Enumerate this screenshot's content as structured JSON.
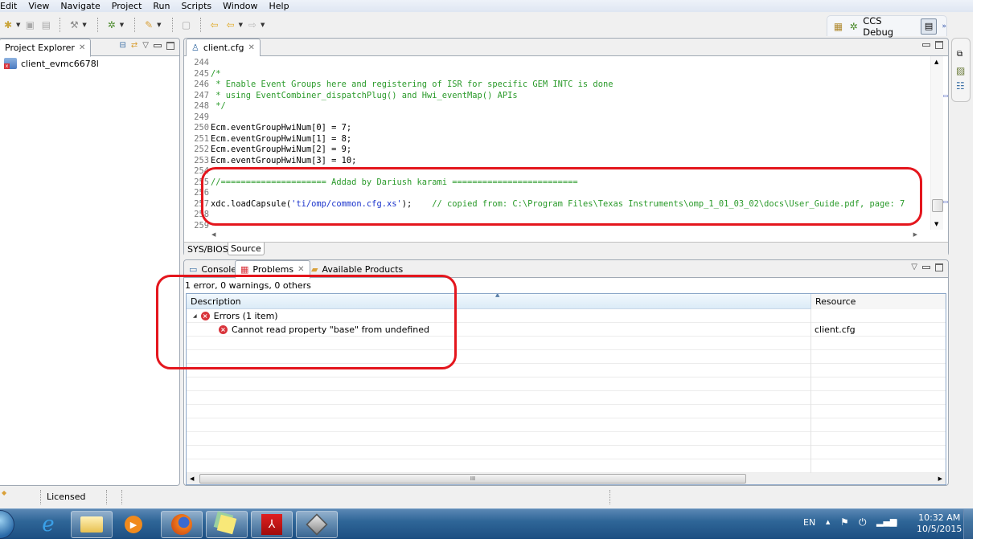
{
  "menu": [
    "Edit",
    "View",
    "Navigate",
    "Project",
    "Run",
    "Scripts",
    "Window",
    "Help"
  ],
  "toolbar": {
    "icons": [
      "new-icon",
      "save-icon",
      "save-all-icon",
      "build-icon",
      "debug-icon",
      "flash-icon",
      "terminate-icon",
      "last-edit-icon",
      "back-icon",
      "forward-icon"
    ]
  },
  "perspective": {
    "label": "CCS Debug",
    "more": "»"
  },
  "project_explorer": {
    "title": "Project Explorer",
    "items": [
      {
        "label": "client_evmc6678l",
        "badge": "RTSC"
      }
    ]
  },
  "editor": {
    "tab": "client.cfg",
    "lines": [
      {
        "n": "244",
        "parts": []
      },
      {
        "n": "245",
        "parts": [
          {
            "t": "/*",
            "c": "cm"
          }
        ]
      },
      {
        "n": "246",
        "parts": [
          {
            "t": " * Enable Event Groups here and registering of ISR for specific GEM INTC is done",
            "c": "cm"
          }
        ]
      },
      {
        "n": "247",
        "parts": [
          {
            "t": " * using EventCombiner_dispatchPlug() and Hwi_eventMap() APIs",
            "c": "cm"
          }
        ]
      },
      {
        "n": "248",
        "parts": [
          {
            "t": " */",
            "c": "cm"
          }
        ]
      },
      {
        "n": "249",
        "parts": []
      },
      {
        "n": "250",
        "parts": [
          {
            "t": "Ecm.eventGroupHwiNum[0] = 7;",
            "c": ""
          }
        ]
      },
      {
        "n": "251",
        "parts": [
          {
            "t": "Ecm.eventGroupHwiNum[1] = 8;",
            "c": ""
          }
        ]
      },
      {
        "n": "252",
        "parts": [
          {
            "t": "Ecm.eventGroupHwiNum[2] = 9;",
            "c": ""
          }
        ]
      },
      {
        "n": "253",
        "parts": [
          {
            "t": "Ecm.eventGroupHwiNum[3] = 10;",
            "c": ""
          }
        ]
      },
      {
        "n": "254",
        "parts": []
      },
      {
        "n": "255",
        "parts": [
          {
            "t": "//===================== Addad by Dariush karami =========================",
            "c": "cm"
          }
        ]
      },
      {
        "n": "256",
        "parts": []
      },
      {
        "n": "257",
        "parts": [
          {
            "t": "xdc.loadCapsule(",
            "c": ""
          },
          {
            "t": "'ti/omp/common.cfg.xs'",
            "c": "str"
          },
          {
            "t": ");    ",
            "c": ""
          },
          {
            "t": "// copied from: C:\\Program Files\\Texas Instruments\\omp_1_01_03_02\\docs\\User_Guide.pdf, page: 7",
            "c": "cm"
          }
        ]
      },
      {
        "n": "258",
        "parts": []
      },
      {
        "n": "259",
        "parts": []
      }
    ],
    "bottom_tabs": [
      "SYS/BIOS",
      "Source"
    ],
    "active_bottom_tab": "Source"
  },
  "bottom_panel": {
    "tabs": [
      {
        "label": "Console",
        "icon": "console-icon"
      },
      {
        "label": "Problems",
        "icon": "problems-icon",
        "active": true
      },
      {
        "label": "Available Products",
        "icon": "folder-icon"
      }
    ],
    "summary": "1 error, 0 warnings, 0 others",
    "columns": [
      "Description",
      "Resource"
    ],
    "rows": [
      {
        "level": 0,
        "expander": "◢",
        "description": "Errors (1 item)",
        "resource": ""
      },
      {
        "level": 1,
        "description": "Cannot read property \"base\" from undefined",
        "resource": "client.cfg"
      }
    ],
    "hscroll_grip": "III"
  },
  "statusbar": {
    "text": "Licensed"
  },
  "taskbar": {
    "apps": [
      "start-button",
      "internet-explorer",
      "file-explorer",
      "media-player",
      "firefox",
      "sticky-notes",
      "adobe-reader",
      "virtualbox"
    ],
    "lang": "EN",
    "time": "10:32 AM",
    "date": "10/5/2015"
  },
  "colors": {
    "annotation": "#e4161d",
    "comment": "#2a9a2a",
    "string": "#1a33cc",
    "error": "#d9343b"
  }
}
